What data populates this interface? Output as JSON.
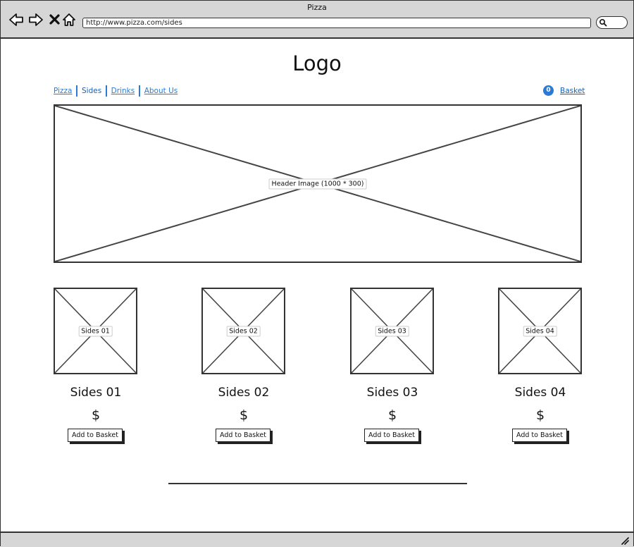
{
  "window": {
    "title": "Pizza"
  },
  "address_bar": {
    "url": "http://www.pizza.com/sides"
  },
  "icons": {
    "back": "back-arrow-icon",
    "forward": "forward-arrow-icon",
    "stop": "stop-x-icon",
    "home": "home-icon",
    "search": "search-icon",
    "resize": "resize-grip-icon"
  },
  "logo": "Logo",
  "nav": {
    "items": [
      {
        "label": "Pizza",
        "active": false
      },
      {
        "label": "Sides",
        "active": true
      },
      {
        "label": "Drinks",
        "active": false
      },
      {
        "label": "About Us",
        "active": false
      }
    ]
  },
  "basket": {
    "count": "0",
    "label": "Basket"
  },
  "header_image": {
    "label": "Header Image (1000 * 300)"
  },
  "products": [
    {
      "image_label": "Sides 01",
      "title": "Sides 01",
      "price": "$",
      "button": "Add to Basket"
    },
    {
      "image_label": "Sides 02",
      "title": "Sides 02",
      "price": "$",
      "button": "Add to Basket"
    },
    {
      "image_label": "Sides 03",
      "title": "Sides 03",
      "price": "$",
      "button": "Add to Basket"
    },
    {
      "image_label": "Sides 04",
      "title": "Sides 04",
      "price": "$",
      "button": "Add to Basket"
    }
  ],
  "colors": {
    "link": "#2b7bd4",
    "badge": "#2b7bd4",
    "chrome": "#d6d6d6"
  }
}
